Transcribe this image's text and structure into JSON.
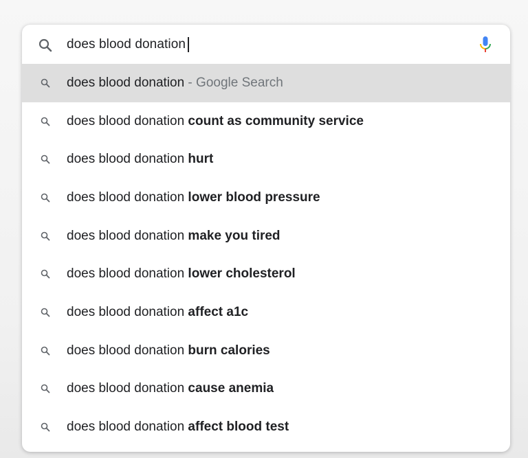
{
  "search": {
    "query": "does blood donation"
  },
  "suggestions": [
    {
      "prefix": "does blood donation",
      "completion": "",
      "suffix": " - Google Search",
      "highlighted": true
    },
    {
      "prefix": "does blood donation",
      "completion": " count as community service",
      "suffix": "",
      "highlighted": false
    },
    {
      "prefix": "does blood donation",
      "completion": " hurt",
      "suffix": "",
      "highlighted": false
    },
    {
      "prefix": "does blood donation",
      "completion": " lower blood pressure",
      "suffix": "",
      "highlighted": false
    },
    {
      "prefix": "does blood donation",
      "completion": " make you tired",
      "suffix": "",
      "highlighted": false
    },
    {
      "prefix": "does blood donation",
      "completion": " lower cholesterol",
      "suffix": "",
      "highlighted": false
    },
    {
      "prefix": "does blood donation",
      "completion": " affect a1c",
      "suffix": "",
      "highlighted": false
    },
    {
      "prefix": "does blood donation",
      "completion": " burn calories",
      "suffix": "",
      "highlighted": false
    },
    {
      "prefix": "does blood donation",
      "completion": " cause anemia",
      "suffix": "",
      "highlighted": false
    },
    {
      "prefix": "does blood donation",
      "completion": " affect blood test",
      "suffix": "",
      "highlighted": false
    }
  ],
  "icons": {
    "search": "search-icon",
    "mic": "mic-icon",
    "suggestion": "search-icon"
  },
  "colors": {
    "highlight": "#dedede",
    "text": "#202124",
    "muted": "#70757a",
    "mic_blue": "#4285f4",
    "mic_red": "#ea4335",
    "mic_yellow": "#fbbc05",
    "mic_green": "#34a853"
  }
}
